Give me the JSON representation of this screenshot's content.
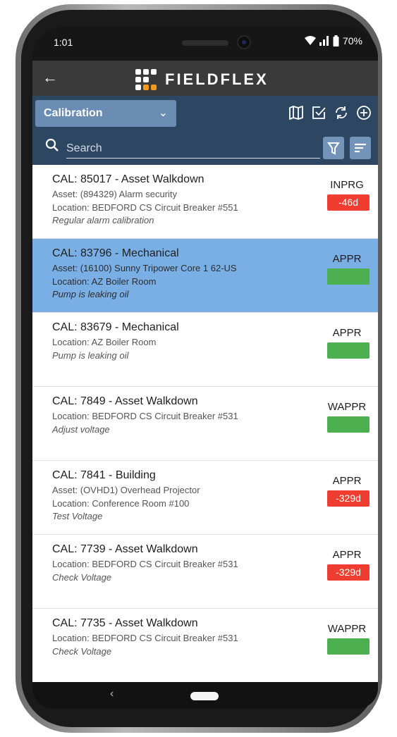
{
  "status_bar": {
    "time": "1:01",
    "battery": "70%"
  },
  "app_bar": {
    "back_icon": "arrow-left-icon",
    "logo_text": "FIELDFLEX"
  },
  "toolbar": {
    "dropdown_value": "Calibration",
    "icons": [
      "map-icon",
      "check-box-icon",
      "sync-icon",
      "add-circle-icon"
    ]
  },
  "search": {
    "placeholder": "Search"
  },
  "colors": {
    "toolbar": "#2d4762",
    "dropdown": "#6b8db3",
    "selected_row": "#7aafe6",
    "overdue_badge": "#ef3d32",
    "ok_badge": "#4caf50"
  },
  "work_orders": [
    {
      "title": "CAL: 85017 - Asset Walkdown",
      "asset": "Asset: (894329) Alarm security",
      "location": "Location: BEDFORD CS Circuit Breaker #551",
      "description": "Regular alarm calibration",
      "status": "INPRG",
      "badge": "-46d",
      "badge_color": "red",
      "selected": false
    },
    {
      "title": "CAL: 83796 - Mechanical",
      "asset": "Asset: (16100) Sunny Tripower Core 1 62-US",
      "location": "Location: AZ Boiler Room",
      "description": "Pump is leaking oil",
      "status": "APPR",
      "badge": "",
      "badge_color": "green",
      "selected": true
    },
    {
      "title": "CAL: 83679 - Mechanical",
      "location": "Location: AZ Boiler Room",
      "description": "Pump is leaking oil",
      "status": "APPR",
      "badge": "",
      "badge_color": "green",
      "selected": false
    },
    {
      "title": "CAL: 7849 - Asset Walkdown",
      "location": "Location: BEDFORD CS Circuit Breaker #531",
      "description": "Adjust voltage",
      "status": "WAPPR",
      "badge": "",
      "badge_color": "green",
      "selected": false
    },
    {
      "title": "CAL: 7841 - Building",
      "asset": "Asset: (OVHD1) Overhead Projector",
      "location": "Location: Conference Room #100",
      "description": "Test Voltage",
      "status": "APPR",
      "badge": "-329d",
      "badge_color": "red",
      "selected": false
    },
    {
      "title": "CAL: 7739 - Asset Walkdown",
      "location": "Location: BEDFORD CS Circuit Breaker #531",
      "description": "Check Voltage",
      "status": "APPR",
      "badge": "-329d",
      "badge_color": "red",
      "selected": false
    },
    {
      "title": "CAL: 7735 - Asset Walkdown",
      "location": "Location: BEDFORD CS Circuit Breaker #531",
      "description": "Check Voltage",
      "status": "WAPPR",
      "badge": "",
      "badge_color": "green",
      "selected": false
    }
  ],
  "nav": {
    "back_icon": "nav-back-icon",
    "home_icon": "home-pill-icon"
  }
}
